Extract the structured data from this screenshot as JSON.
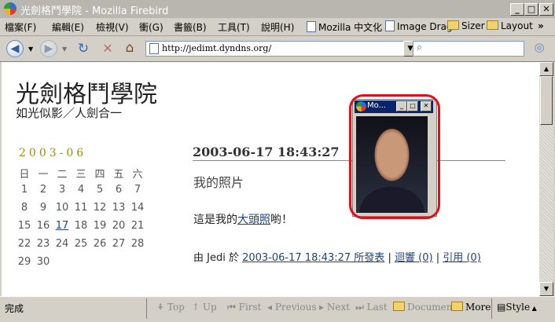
{
  "window": {
    "title": "光劍格鬥學院 - Mozilla Firebird"
  },
  "menu": {
    "items": [
      "檔案(F)",
      "編輯(E)",
      "檢視(V)",
      "衝(G)",
      "書籤(B)",
      "工具(T)",
      "說明(H)"
    ],
    "bookmarks": [
      {
        "label": "Mozilla 中文化",
        "icon": "page-icon"
      },
      {
        "label": "Image Drag",
        "icon": "page-icon"
      },
      {
        "label": "Sizer",
        "icon": "folder-icon"
      },
      {
        "label": "Layout",
        "icon": "folder-icon"
      }
    ],
    "overflow": "»"
  },
  "nav": {
    "url": "http://jedimt.dyndns.org/",
    "search_placeholder": ""
  },
  "page": {
    "site_title": "光劍格鬥學院",
    "tagline": "如光似影／人劍合一",
    "calendar": {
      "month": "2003-06",
      "weekdays": [
        "日",
        "一",
        "二",
        "三",
        "四",
        "五",
        "六"
      ],
      "rows": [
        [
          "1",
          "2",
          "3",
          "4",
          "5",
          "6",
          "7"
        ],
        [
          "8",
          "9",
          "10",
          "11",
          "12",
          "13",
          "14"
        ],
        [
          "15",
          "16",
          "17",
          "18",
          "19",
          "20",
          "21"
        ],
        [
          "22",
          "23",
          "24",
          "25",
          "26",
          "27",
          "28"
        ],
        [
          "29",
          "30"
        ]
      ],
      "linked_day": "17"
    },
    "post": {
      "date": "2003-06-17 18:43:27",
      "title": "我的照片",
      "body_before": "這是我的",
      "body_link": "大頭照",
      "body_after": "喲！",
      "footer_by": "由 Jedi 於",
      "footer_link": "2003-06-17 18:43:27 所發表",
      "sep1": "|",
      "comments": "迴響 (0)",
      "sep2": "|",
      "trackback": "引用 (0)"
    }
  },
  "popup": {
    "title": "Mo..."
  },
  "status": {
    "text": "完成",
    "nav_items": [
      "Top",
      "Up",
      "First",
      "Previous",
      "Next",
      "Last"
    ],
    "document": "Document",
    "more": "More",
    "style": "Style"
  },
  "colors": {
    "highlight_ring": "#e0101a",
    "link": "#224477"
  }
}
